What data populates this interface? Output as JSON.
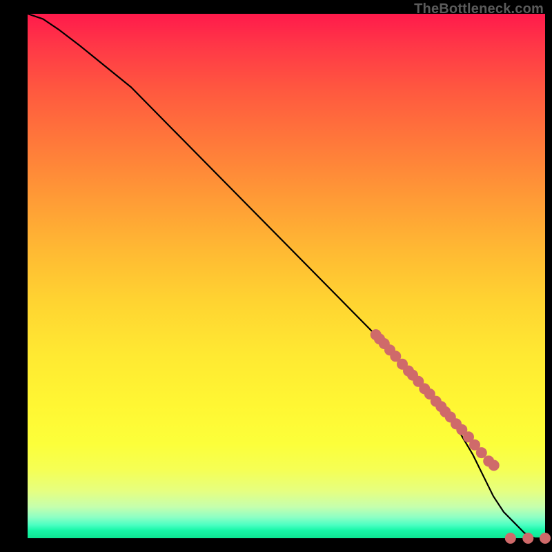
{
  "watermark": "TheBottleneck.com",
  "colors": {
    "curve_stroke": "#000000",
    "dot_fill": "#cf6a6a",
    "dot_stroke": "#cf6a6a",
    "background": "#000000"
  },
  "chart_data": {
    "type": "line",
    "title": "",
    "xlabel": "",
    "ylabel": "",
    "xlim": [
      0,
      100
    ],
    "ylim": [
      0,
      100
    ],
    "grid": false,
    "legend": false,
    "annotations": [],
    "series": [
      {
        "name": "curve",
        "style": "line",
        "x": [
          0,
          3,
          6,
          10,
          15,
          20,
          30,
          40,
          50,
          60,
          70,
          78,
          83,
          86,
          88,
          90,
          92,
          94,
          96,
          98,
          100
        ],
        "y": [
          100,
          99,
          97,
          94,
          90,
          86,
          76,
          66,
          56,
          46,
          36,
          27,
          21,
          16,
          12,
          8,
          5,
          3,
          1,
          0,
          0
        ]
      },
      {
        "name": "dotted-tail",
        "style": "points",
        "x": [
          67.3,
          68.0,
          68.9,
          70.0,
          71.1,
          72.4,
          73.6,
          74.4,
          75.5,
          76.7,
          77.7,
          78.9,
          79.9,
          80.7,
          81.7,
          82.8,
          83.9,
          85.2,
          86.4,
          87.7,
          89.1,
          90.1,
          93.3,
          96.7,
          100.0
        ],
        "y": [
          38.8,
          38.0,
          37.1,
          35.9,
          34.7,
          33.2,
          31.9,
          31.1,
          29.9,
          28.5,
          27.5,
          26.1,
          25.1,
          24.1,
          23.1,
          21.8,
          20.7,
          19.3,
          17.8,
          16.3,
          14.7,
          13.9,
          0.0,
          0.0,
          0.0
        ]
      }
    ]
  }
}
